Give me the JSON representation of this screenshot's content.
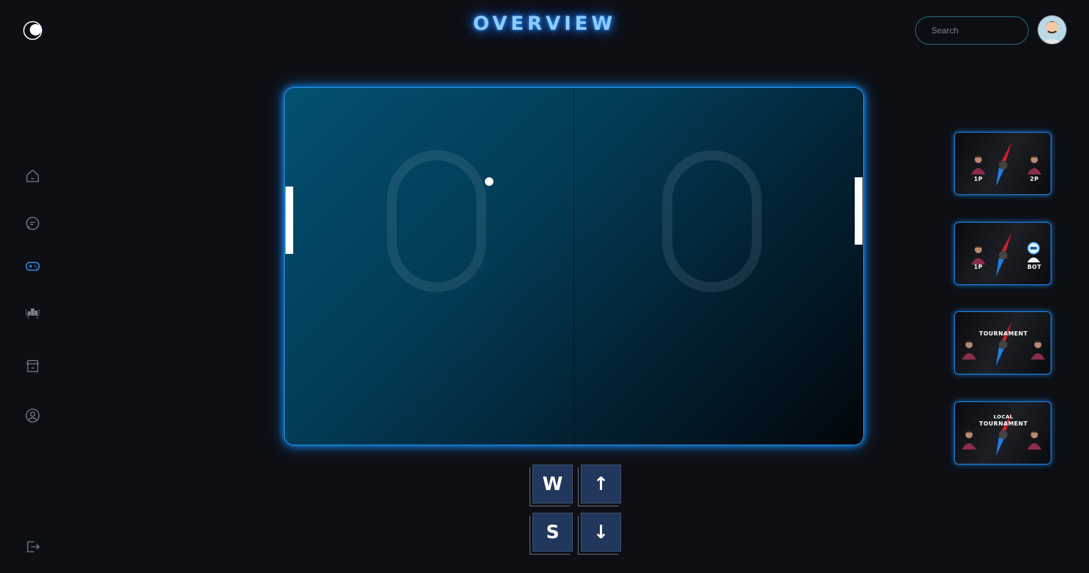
{
  "header": {
    "title": "OVERVIEW",
    "search_placeholder": "Search"
  },
  "sidebar": {
    "items": [
      {
        "icon": "home-icon",
        "active": false
      },
      {
        "icon": "chat-icon",
        "active": false
      },
      {
        "icon": "gamepad-icon",
        "active": true
      },
      {
        "icon": "leaderboard-icon",
        "active": false
      },
      {
        "icon": "store-icon",
        "active": false
      },
      {
        "icon": "profile-icon",
        "active": false
      }
    ],
    "logout_icon": "logout-icon"
  },
  "game": {
    "score_left": "0",
    "score_right": "0"
  },
  "controls": {
    "key_w": "W",
    "key_s": "S",
    "key_up": "↑",
    "key_down": "↓"
  },
  "modes": [
    {
      "left_label": "1P",
      "right_label": "2P"
    },
    {
      "left_label": "1P",
      "right_label": "BOT"
    },
    {
      "title": "TOURNAMENT"
    },
    {
      "title_line1": "LOCAL",
      "title_line2": "TOURNAMENT"
    }
  ],
  "colors": {
    "accent": "#1d8ef5",
    "background": "#0d0f15",
    "key": "#22375c"
  }
}
